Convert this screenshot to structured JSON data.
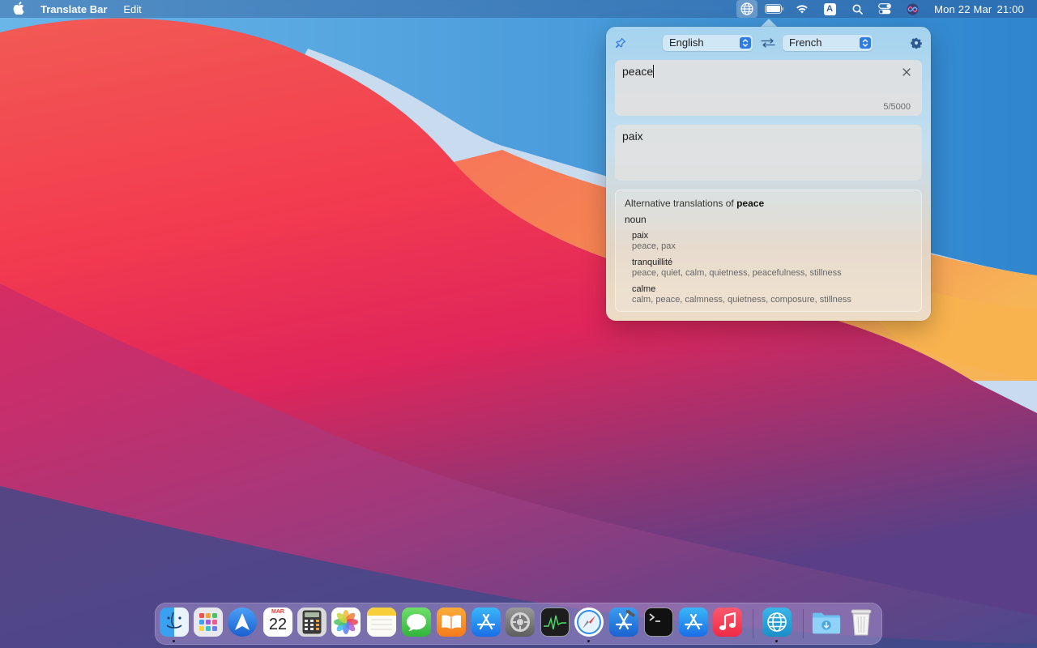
{
  "menubar": {
    "app_name": "Translate Bar",
    "menus": [
      "Edit"
    ],
    "icons": [
      "apple-icon",
      "translate-globe-icon",
      "battery-icon",
      "wifi-icon",
      "input-source-icon",
      "spotlight-search-icon",
      "control-center-icon",
      "siri-icon"
    ],
    "input_source_letter": "A",
    "clock_day": "Mon 22 Mar",
    "clock_time": "21:00"
  },
  "translator": {
    "source_language": "English",
    "target_language": "French",
    "source_text": "peace",
    "char_count": "5/5000",
    "translated_text": "paix",
    "alternatives": {
      "heading_prefix": "Alternative translations of",
      "heading_word": "peace",
      "part_of_speech": "noun",
      "entries": [
        {
          "word": "paix",
          "synonyms": "peace, pax"
        },
        {
          "word": "tranquillité",
          "synonyms": "peace, quiet, calm, quietness, peacefulness, stillness"
        },
        {
          "word": "calme",
          "synonyms": "calm, peace, calmness, quietness, composure, stillness"
        }
      ]
    }
  },
  "dock": {
    "calendar_month": "MAR",
    "calendar_day": "22",
    "apps": [
      "Finder",
      "Launchpad",
      "Spark",
      "Calendar",
      "Calculator",
      "Photos",
      "Notes",
      "Messages",
      "Books",
      "App Store",
      "System Preferences",
      "Activity Monitor",
      "Safari",
      "Xcode",
      "Terminal",
      "App Store",
      "Music",
      "Translate Bar",
      "Downloads",
      "Trash"
    ]
  },
  "colors": {
    "accent_blue": "#2d7be5",
    "wallpaper_red": "#f0284a",
    "wallpaper_orange": "#f6925a"
  }
}
